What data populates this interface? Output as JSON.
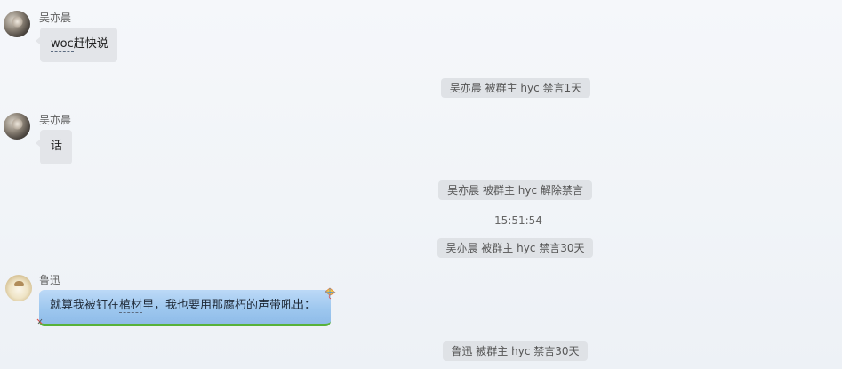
{
  "messages": [
    {
      "sender": "吴亦晨",
      "text_part1": "woc",
      "text_part2": "赶快说"
    },
    {
      "sender": "吴亦晨",
      "text": "话"
    },
    {
      "sender": "鲁迅",
      "text_part1": "就算我被钉在",
      "text_part2": "棺材",
      "text_part3": "里，我也要用那腐朽的声带吼出："
    }
  ],
  "system_notices": [
    "吴亦晨 被群主 hyc 禁言1天",
    "吴亦晨 被群主 hyc 解除禁言",
    "吴亦晨 被群主 hyc 禁言30天",
    "鲁迅 被群主 hyc 禁言30天"
  ],
  "timestamp": "15:51:54",
  "colors": {
    "bubble": "#e3e5e9",
    "special_bubble": "#9cc6ee",
    "special_bubble_border": "#58b23a",
    "system_pill": "#dfe2e6"
  }
}
